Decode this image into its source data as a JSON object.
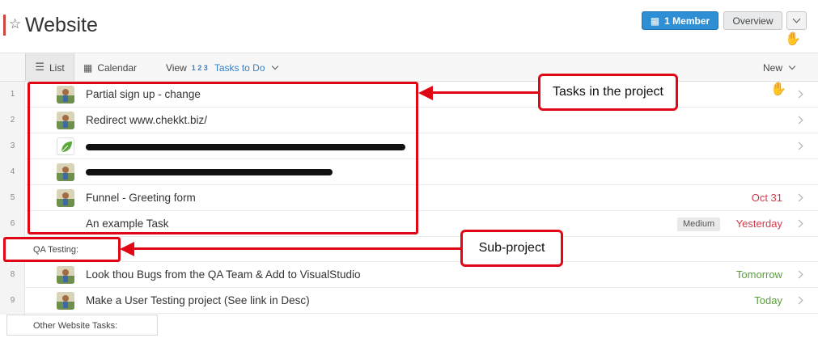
{
  "header": {
    "title": "Website",
    "member_button": "1 Member",
    "overview_button": "Overview"
  },
  "toolbar": {
    "list_tab": "List",
    "calendar_tab": "Calendar",
    "view_label": "View",
    "view_value": "Tasks to Do",
    "view_value_icon": "1 2 3",
    "new_label": "New"
  },
  "tasks": [
    {
      "num": "1",
      "name": "Partial sign up - change",
      "due": ""
    },
    {
      "num": "2",
      "name": "Redirect www.chekkt.biz/",
      "due": ""
    },
    {
      "num": "3",
      "name": "",
      "due": ""
    },
    {
      "num": "4",
      "name": "",
      "due": ""
    },
    {
      "num": "5",
      "name": "Funnel - Greeting form",
      "due": "Oct 31"
    },
    {
      "num": "6",
      "name": "An example Task",
      "badge": "Medium",
      "due": "Yesterday"
    }
  ],
  "sections": {
    "qa": "QA Testing:",
    "other": "Other Website Tasks:"
  },
  "qa_tasks": [
    {
      "num": "8",
      "name": "Look thou Bugs from the QA Team & Add to VisualStudio",
      "due": "Tomorrow"
    },
    {
      "num": "9",
      "name": "Make a User Testing project (See link in Desc)",
      "due": "Today"
    }
  ],
  "annotations": {
    "tasks_callout": "Tasks in the project",
    "subproject_callout": "Sub-project",
    "color": "#e10613"
  },
  "icons": [
    "star-icon",
    "building-icon",
    "chevron-down-icon",
    "list-icon",
    "calendar-icon",
    "chevron-right-icon",
    "avatar",
    "cursor-icon"
  ]
}
